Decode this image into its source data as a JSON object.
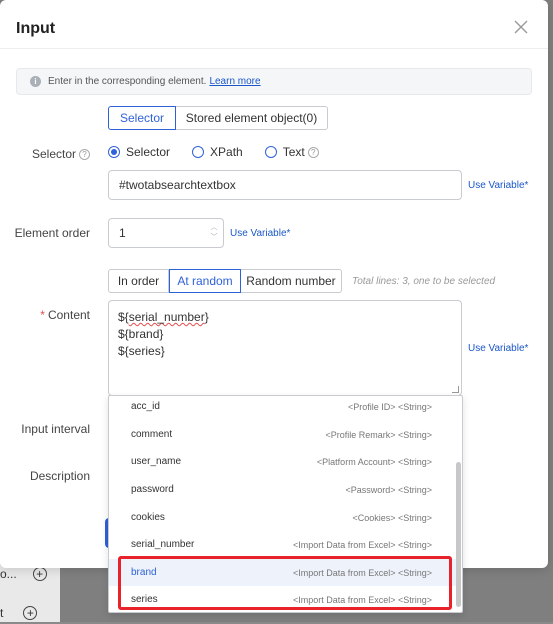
{
  "dialog": {
    "title": "Input"
  },
  "info": {
    "text": "Enter in the corresponding element.",
    "link": "Learn more"
  },
  "selector_tabs": [
    "Selector",
    "Stored element object(0)"
  ],
  "labels": {
    "selector": "Selector",
    "element_order": "Element order",
    "content": "Content",
    "input_interval": "Input interval",
    "description": "Description"
  },
  "selector_type": {
    "options": [
      "Selector",
      "XPath",
      "Text"
    ],
    "selected": "Selector"
  },
  "selector_value": "#twotabsearchtextbox",
  "use_variable": "Use Variable*",
  "element_order_value": "1",
  "order_tabs": [
    "In order",
    "At random",
    "Random number"
  ],
  "order_selected": "At random",
  "hint": "Total lines: 3, one to be selected",
  "content_lines": [
    "${serial_number}",
    "${brand}",
    "${series}"
  ],
  "dropdown_items": [
    {
      "name": "acc_id",
      "type": "<Profile ID> <String>"
    },
    {
      "name": "comment",
      "type": "<Profile Remark> <String>"
    },
    {
      "name": "user_name",
      "type": "<Platform Account> <String>"
    },
    {
      "name": "password",
      "type": "<Password> <String>"
    },
    {
      "name": "cookies",
      "type": "<Cookies> <String>"
    },
    {
      "name": "serial_number",
      "type": "<Import Data from Excel> <String>"
    },
    {
      "name": "brand",
      "type": "<Import Data from Excel> <String>"
    },
    {
      "name": "series",
      "type": "<Import Data from Excel> <String>"
    }
  ],
  "background": {
    "row1": "o...",
    "row2": "t"
  },
  "colors": {
    "accent": "#2f62d8",
    "highlight_box": "#e8212a"
  }
}
